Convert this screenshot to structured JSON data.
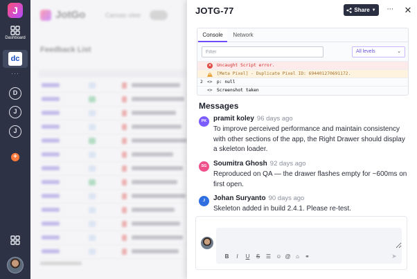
{
  "rail": {
    "logo_letter": "J",
    "dashboard_label": "Dashboard",
    "workspace_abbrev": "dc",
    "more_glyph": "···",
    "circle_items": [
      "D",
      "J",
      "J"
    ],
    "add_glyph": "+"
  },
  "background": {
    "brand": "JotGo",
    "canvas_view_label": "Canvas view",
    "list_title": "Feedback List"
  },
  "drawer": {
    "title": "JOTG-77",
    "share_label": "Share",
    "more_glyph": "···",
    "close_glyph": "✕",
    "console": {
      "tabs": [
        {
          "label": "Console",
          "active": true
        },
        {
          "label": "Network",
          "active": false
        }
      ],
      "filter_placeholder": "Filter",
      "level_select": "All levels",
      "logs": [
        {
          "kind": "error",
          "text": "Uncaught Script error."
        },
        {
          "kind": "warning",
          "text": "[Meta Pixel] - Duplicate Pixel ID: 694401270691172."
        },
        {
          "kind": "log",
          "count": "2",
          "text": "p: null"
        },
        {
          "kind": "log",
          "count": "",
          "text": "Screenshot taken"
        }
      ]
    },
    "messages_title": "Messages",
    "messages": [
      {
        "initials": "PK",
        "avatar_color": "#7b5cff",
        "author": "pramit koley",
        "time": "96 days ago",
        "body": "To improve perceived performance and maintain consistency with other sections of the app, the Right Drawer should display a skeleton loader."
      },
      {
        "initials": "SG",
        "avatar_color": "#f0508a",
        "author": "Soumitra Ghosh",
        "time": "92 days ago",
        "body": "Reproduced on QA — the drawer flashes empty for ~600ms on first open."
      },
      {
        "initials": "J",
        "avatar_color": "#2f6fe0",
        "author": "Johan Suryanto",
        "time": "90 days ago",
        "body": "Skeleton added in build 2.4.1. Please re-test."
      }
    ],
    "composer": {
      "placeholder": "",
      "send_glyph": "➤"
    }
  },
  "colors": {
    "rail_bg": "#2d3344",
    "accent": "#6c4df6",
    "share_bg": "#2a3042"
  }
}
